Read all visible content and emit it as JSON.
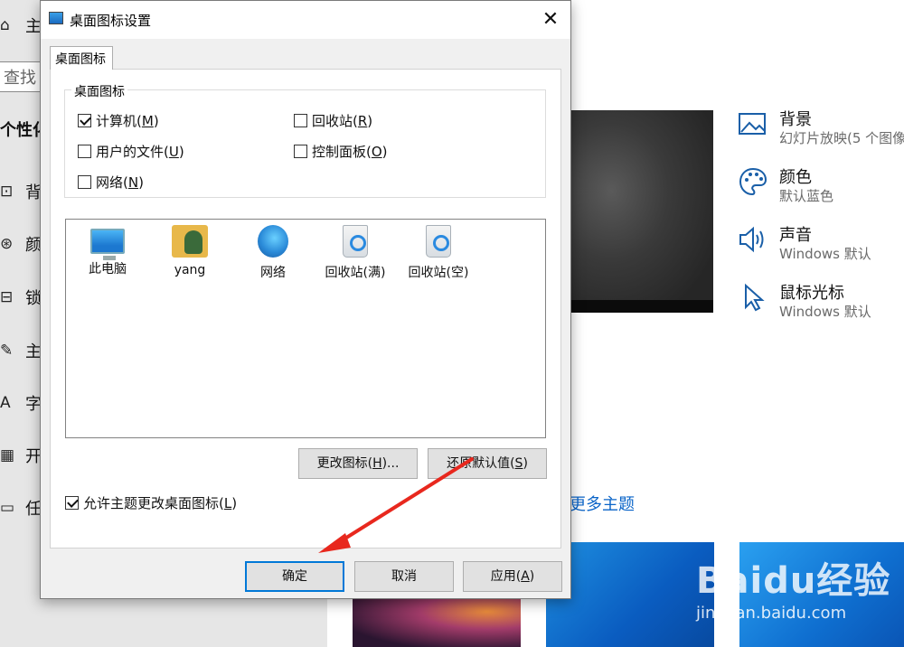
{
  "settings_sidebar": {
    "home_label": "主",
    "search_placeholder": "查找",
    "section_heading": "个性化",
    "items": [
      {
        "icon": "image-icon",
        "glyph": "⊡",
        "label": "背"
      },
      {
        "icon": "palette-icon",
        "glyph": "⊛",
        "label": "颜"
      },
      {
        "icon": "lock-screen-icon",
        "glyph": "⊟",
        "label": "锁"
      },
      {
        "icon": "brush-icon",
        "glyph": "✎",
        "label": "主"
      },
      {
        "icon": "font-icon",
        "glyph": "A",
        "label": "字"
      },
      {
        "icon": "start-icon",
        "glyph": "▦",
        "label": "开"
      },
      {
        "icon": "taskbar-icon",
        "glyph": "▭",
        "label": "任"
      }
    ]
  },
  "settings_main": {
    "items": [
      {
        "title": "背景",
        "subtitle": "幻灯片放映(5 个图像",
        "icon": "picture-icon"
      },
      {
        "title": "颜色",
        "subtitle": "默认蓝色",
        "icon": "palette-icon"
      },
      {
        "title": "声音",
        "subtitle": "Windows 默认",
        "icon": "speaker-icon"
      },
      {
        "title": "鼠标光标",
        "subtitle": "Windows 默认",
        "icon": "cursor-icon"
      }
    ],
    "more_themes_link": "更多主题"
  },
  "watermark": {
    "logo": "Baidu经验",
    "url": "jingyan.baidu.com"
  },
  "dialog": {
    "title": "桌面图标设置",
    "close_glyph": "✕",
    "tab_label": "桌面图标",
    "group_title": "桌面图标",
    "checkboxes": [
      {
        "label": "计算机(",
        "key": "M",
        "suffix": ")",
        "checked": true
      },
      {
        "label": "回收站(",
        "key": "R",
        "suffix": ")",
        "checked": false
      },
      {
        "label": "用户的文件(",
        "key": "U",
        "suffix": ")",
        "checked": false
      },
      {
        "label": "控制面板(",
        "key": "O",
        "suffix": ")",
        "checked": false
      },
      {
        "label": "网络(",
        "key": "N",
        "suffix": ")",
        "checked": false
      }
    ],
    "icons": [
      {
        "label": "此电脑",
        "icon": "computer-icon"
      },
      {
        "label": "yang",
        "icon": "user-folder-icon"
      },
      {
        "label": "网络",
        "icon": "network-icon"
      },
      {
        "label": "回收站(满)",
        "icon": "recycle-bin-full-icon"
      },
      {
        "label": "回收站(空)",
        "icon": "recycle-bin-empty-icon"
      }
    ],
    "change_icon_button": {
      "pre": "更改图标(",
      "key": "H",
      "post": ")..."
    },
    "restore_default_button": {
      "pre": "还原默认值(",
      "key": "S",
      "post": ")"
    },
    "allow_themes_checkbox": {
      "pre": "允许主题更改桌面图标(",
      "key": "L",
      "post": ")",
      "checked": true
    },
    "ok_button": "确定",
    "cancel_button": "取消",
    "apply_button": {
      "pre": "应用(",
      "key": "A",
      "post": ")"
    }
  },
  "annotation": {
    "arrow_color": "#e8281e"
  }
}
